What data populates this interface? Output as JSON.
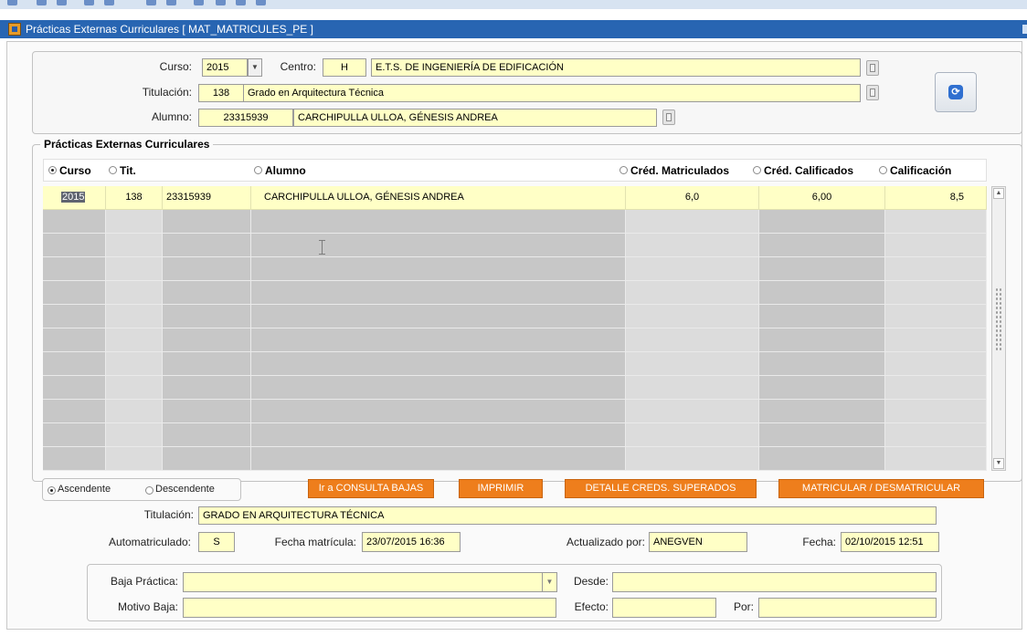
{
  "window": {
    "title": "Prácticas Externas Curriculares [ MAT_MATRICULES_PE ]"
  },
  "header": {
    "curso_label": "Curso:",
    "curso_value": "2015",
    "centro_label": "Centro:",
    "centro_code": "H",
    "centro_name": "E.T.S. DE INGENIERÍA DE EDIFICACIÓN",
    "titulacion_label": "Titulación:",
    "titulacion_code": "138",
    "titulacion_name": "Grado en Arquitectura Técnica",
    "alumno_label": "Alumno:",
    "alumno_id": "23315939",
    "alumno_name": "CARCHIPULLA ULLOA, GÉNESIS ANDREA"
  },
  "section": {
    "title": "Prácticas Externas Curriculares"
  },
  "table": {
    "columns": {
      "curso": "Curso",
      "tit": "Tit.",
      "alumno": "Alumno",
      "cred_mat": "Créd. Matriculados",
      "cred_cal": "Créd. Calificados",
      "calif": "Calificación"
    },
    "rows": [
      {
        "curso": "2015",
        "tit": "138",
        "alumno_id": "23315939",
        "alumno_name": "CARCHIPULLA ULLOA, GÉNESIS ANDREA",
        "cred_mat": "6,0",
        "cred_cal": "6,00",
        "calif": "8,5"
      }
    ]
  },
  "sort": {
    "asc": "Ascendente",
    "desc": "Descendente"
  },
  "buttons": {
    "consulta_bajas": "Ir a CONSULTA BAJAS",
    "imprimir": "IMPRIMIR",
    "detalle": "DETALLE CREDS. SUPERADOS",
    "matricular": "MATRICULAR / DESMATRICULAR"
  },
  "detail": {
    "titulacion_label": "Titulación:",
    "titulacion_value": "GRADO EN ARQUITECTURA TÉCNICA",
    "automat_label": "Automatriculado:",
    "automat_value": "S",
    "fecha_mat_label": "Fecha matrícula:",
    "fecha_mat_value": "23/07/2015 16:36",
    "actualizado_label": "Actualizado por:",
    "actualizado_value": "ANEGVEN",
    "fecha_label": "Fecha:",
    "fecha_value": "02/10/2015 12:51"
  },
  "baja": {
    "baja_label": "Baja Práctica:",
    "baja_value": "",
    "desde_label": "Desde:",
    "desde_value": "",
    "motivo_label": "Motivo Baja:",
    "motivo_value": "",
    "efecto_label": "Efecto:",
    "efecto_value": "",
    "por_label": "Por:",
    "por_value": ""
  },
  "colors": {
    "field_bg": "#ffffc6",
    "button_orange": "#ee7e1c",
    "titlebar": "#2865b2"
  }
}
